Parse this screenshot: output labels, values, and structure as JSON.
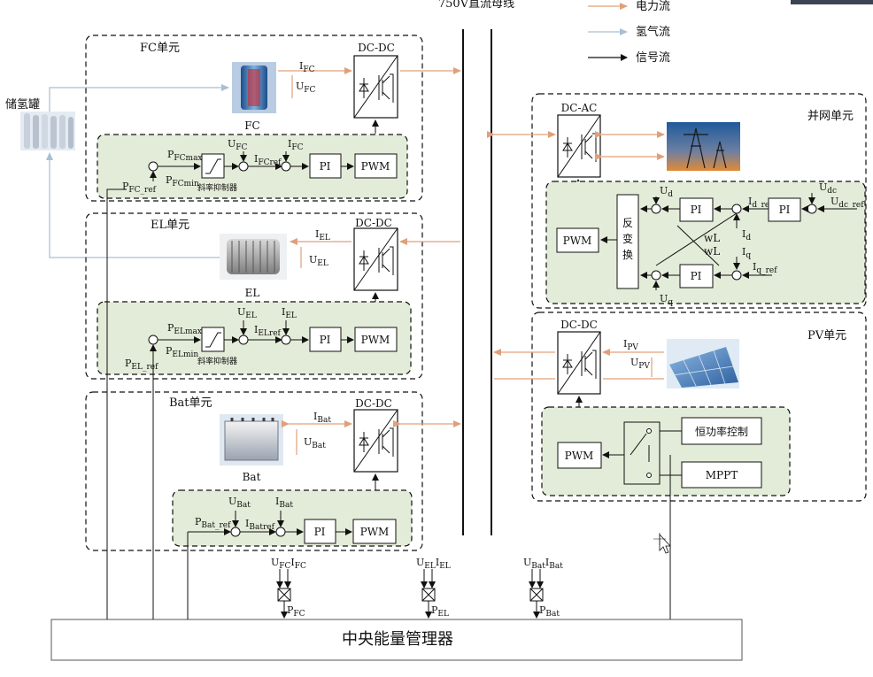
{
  "top_bus_label": "750V直流母线",
  "legend": [
    {
      "label": "电力流",
      "color": "#e0a07a"
    },
    {
      "label": "氢气流",
      "color": "#a9bfd3"
    },
    {
      "label": "信号流",
      "color": "#111111"
    }
  ],
  "tank_label": "储氢罐",
  "units": {
    "fc": {
      "title": "FC单元",
      "device": "FC",
      "converter": "DC-DC",
      "i": "I",
      "i_sub": "FC",
      "u": "U",
      "u_sub": "FC",
      "ctrl": {
        "pmax": "P",
        "pmax_sub": "FCmax",
        "pmin": "P",
        "pmin_sub": "FCmin",
        "pref": "P",
        "pref_sub": "FC_ref",
        "limiter": "斜率抑制器",
        "ufb": "U",
        "ufb_sub": "FC",
        "iref": "I",
        "iref_sub": "FCref",
        "ifb": "I",
        "ifb_sub": "FC",
        "pi": "PI",
        "pwm": "PWM"
      }
    },
    "el": {
      "title": "EL单元",
      "device": "EL",
      "converter": "DC-DC",
      "i": "I",
      "i_sub": "EL",
      "u": "U",
      "u_sub": "EL",
      "ctrl": {
        "pmax": "P",
        "pmax_sub": "ELmax",
        "pmin": "P",
        "pmin_sub": "ELmin",
        "pref": "P",
        "pref_sub": "EL_ref",
        "limiter": "斜率抑制器",
        "ufb": "U",
        "ufb_sub": "EL",
        "iref": "I",
        "iref_sub": "ELref",
        "ifb": "I",
        "ifb_sub": "EL",
        "pi": "PI",
        "pwm": "PWM"
      }
    },
    "bat": {
      "title": "Bat单元",
      "device": "Bat",
      "converter": "DC-DC",
      "i": "I",
      "i_sub": "Bat",
      "u": "U",
      "u_sub": "Bat",
      "ctrl": {
        "pref": "P",
        "pref_sub": "Bat_ref",
        "ufb": "U",
        "ufb_sub": "Bat",
        "iref": "I",
        "iref_sub": "Batref",
        "ifb": "I",
        "ifb_sub": "Bat",
        "pi": "PI",
        "pwm": "PWM"
      }
    },
    "grid": {
      "title": "并网单元",
      "converter": "DC-AC",
      "ctrl": {
        "ud": "U",
        "ud_sub": "d",
        "uq": "U",
        "uq_sub": "q",
        "udc": "U",
        "udc_sub": "dc",
        "udcref": "U",
        "udcref_sub": "dc_ref",
        "idref": "I",
        "idref_sub": "d_ref",
        "id": "I",
        "id_sub": "d",
        "iq": "I",
        "iq_sub": "q",
        "iqref": "I",
        "iqref_sub": "q_ref",
        "wl1": "wL",
        "wl2": "wL",
        "pi1": "PI",
        "pi2": "PI",
        "pi3": "PI",
        "inv": "反变换",
        "pwm": "PWM"
      }
    },
    "pv": {
      "title": "PV单元",
      "converter": "DC-DC",
      "i": "I",
      "i_sub": "PV",
      "u": "U",
      "u_sub": "PV",
      "ctrl": {
        "const": "恒功率控制",
        "mppt": "MPPT",
        "pwm": "PWM"
      }
    }
  },
  "manager": {
    "label": "中央能量管理器",
    "inputs": [
      {
        "u": "U",
        "u_sub": "FC",
        "i": "I",
        "i_sub": "FC",
        "p": "P",
        "p_sub": "FC"
      },
      {
        "u": "U",
        "u_sub": "EL",
        "i": "I",
        "i_sub": "EL",
        "p": "P",
        "p_sub": "EL"
      },
      {
        "u": "U",
        "u_sub": "Bat",
        "i": "I",
        "i_sub": "Bat",
        "p": "P",
        "p_sub": "Bat"
      }
    ]
  }
}
